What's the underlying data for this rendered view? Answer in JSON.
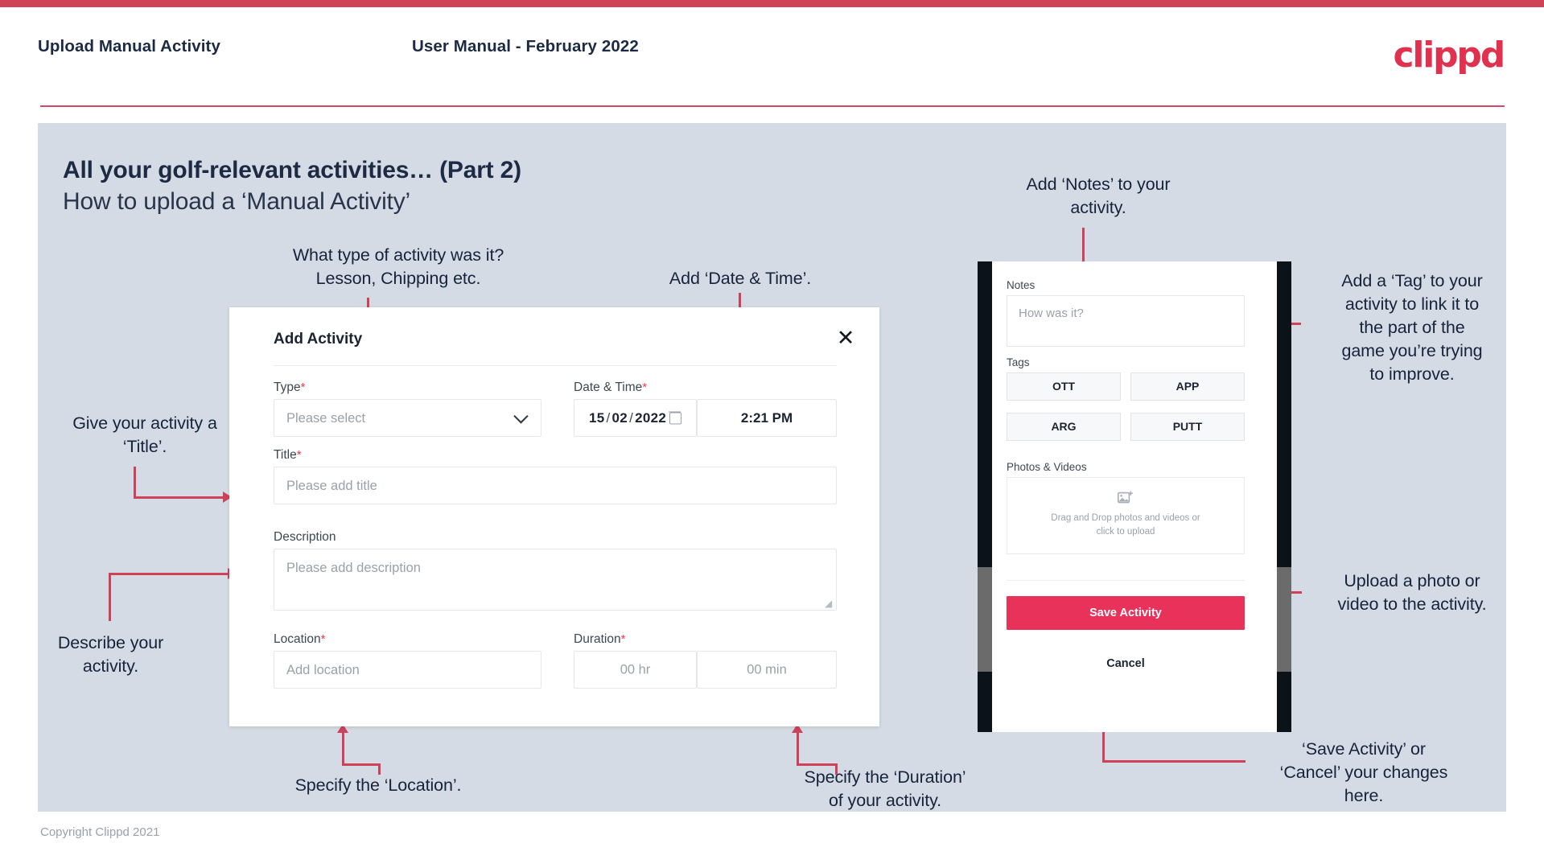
{
  "header": {
    "title": "Upload Manual Activity",
    "subtitle": "User Manual - February 2022",
    "logo": "clippd"
  },
  "slide": {
    "title": "All your golf-relevant activities… (Part 2)",
    "subtitle": "How to upload a ‘Manual Activity’"
  },
  "dialog": {
    "title": "Add Activity",
    "close_icon": "close-icon",
    "fields": {
      "type": {
        "label": "Type",
        "required": "*",
        "placeholder": "Please select"
      },
      "datetime": {
        "label": "Date & Time",
        "required": "*",
        "day": "15",
        "month": "02",
        "year": "2022",
        "time": "2:21 PM"
      },
      "title": {
        "label": "Title",
        "required": "*",
        "placeholder": "Please add title"
      },
      "description": {
        "label": "Description",
        "placeholder": "Please add description"
      },
      "location": {
        "label": "Location",
        "required": "*",
        "placeholder": "Add location"
      },
      "duration": {
        "label": "Duration",
        "required": "*",
        "hours": "00 hr",
        "minutes": "00 min"
      }
    }
  },
  "phone": {
    "notes": {
      "label": "Notes",
      "placeholder": "How was it?"
    },
    "tags": {
      "label": "Tags",
      "items": [
        "OTT",
        "APP",
        "ARG",
        "PUTT"
      ]
    },
    "photos": {
      "label": "Photos & Videos",
      "dropzone_line1": "Drag and Drop photos and videos or",
      "dropzone_line2": "click to upload",
      "icon": "add-image-icon"
    },
    "save_label": "Save Activity",
    "cancel_label": "Cancel"
  },
  "annotations": {
    "type": "What type of activity was it?\nLesson, Chipping etc.",
    "datetime": "Add ‘Date & Time’.",
    "title": "Give your activity a\n‘Title’.",
    "description": "Describe your\nactivity.",
    "location": "Specify the ‘Location’.",
    "duration": "Specify the ‘Duration’\nof your activity.",
    "notes": "Add ‘Notes’ to your\nactivity.",
    "tags": "Add a ‘Tag’ to your\nactivity to link it to\nthe part of the\ngame you’re trying\nto improve.",
    "photos": "Upload a photo or\nvideo to the activity.",
    "save": "‘Save Activity’ or\n‘Cancel’ your changes\nhere."
  },
  "footer": {
    "copyright": "Copyright Clippd 2021"
  },
  "colors": {
    "brand": "#e0314f",
    "accent": "#cf4158",
    "slide_bg": "#d5dbe4",
    "text": "#1c2a44",
    "save_button": "#e8325a"
  }
}
